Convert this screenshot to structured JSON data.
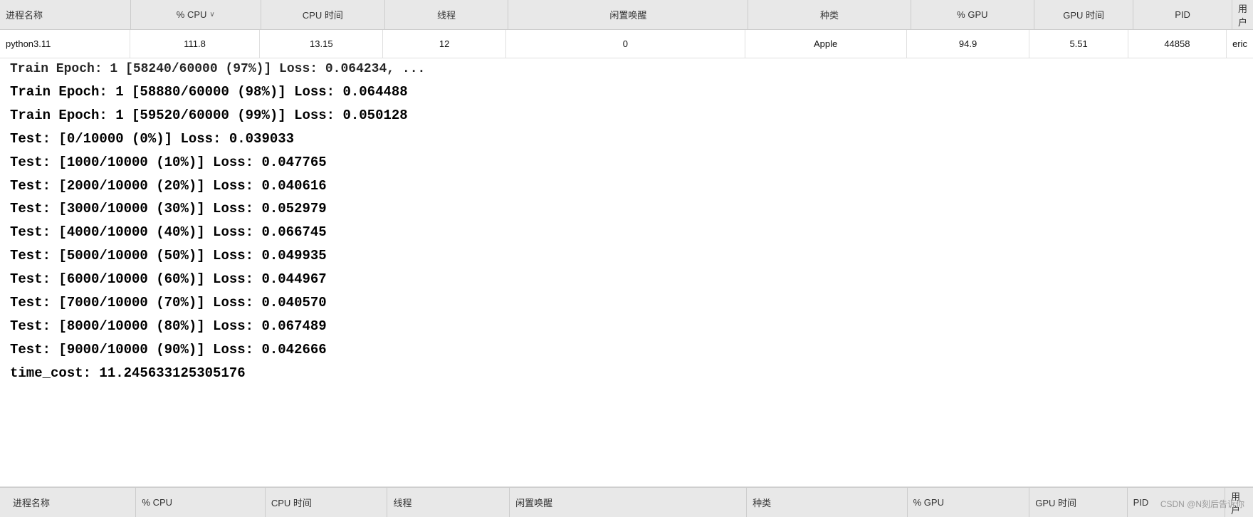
{
  "header": {
    "columns": [
      {
        "id": "process-name",
        "label": "进程名称",
        "sortable": false
      },
      {
        "id": "cpu-pct",
        "label": "% CPU",
        "sortable": true,
        "sort_dir": "desc"
      },
      {
        "id": "cpu-time",
        "label": "CPU 时间",
        "sortable": false
      },
      {
        "id": "threads",
        "label": "线程",
        "sortable": false
      },
      {
        "id": "idle-wake",
        "label": "闲置唤醒",
        "sortable": false
      },
      {
        "id": "kind",
        "label": "种类",
        "sortable": false
      },
      {
        "id": "gpu-pct",
        "label": "% GPU",
        "sortable": false
      },
      {
        "id": "gpu-time",
        "label": "GPU 时间",
        "sortable": false
      },
      {
        "id": "pid",
        "label": "PID",
        "sortable": false
      },
      {
        "id": "user",
        "label": "用户",
        "sortable": false
      }
    ]
  },
  "data_row": {
    "process_name": "python3.11",
    "cpu_pct": "111.8",
    "cpu_time": "13.15",
    "threads": "12",
    "idle_wake": "0",
    "kind": "Apple",
    "gpu_pct": "94.9",
    "gpu_time": "5.51",
    "pid": "44858",
    "user": "eric"
  },
  "terminal": {
    "partial_line": "Train Epoch: 1 [58240/60000 (97%)]    Loss: 0.064234, ...",
    "lines": [
      "Train Epoch: 1 [58880/60000 (98%)]      Loss: 0.064488",
      "Train Epoch: 1 [59520/60000 (99%)]      Loss: 0.050128",
      "Test:  [0/10000 (0%)]     Loss: 0.039033",
      "Test:  [1000/10000 (10%)]      Loss: 0.047765",
      "Test:  [2000/10000 (20%)]      Loss: 0.040616",
      "Test:  [3000/10000 (30%)]      Loss: 0.052979",
      "Test:  [4000/10000 (40%)]      Loss: 0.066745",
      "Test:  [5000/10000 (50%)]      Loss: 0.049935",
      "Test:  [6000/10000 (60%)]      Loss: 0.044967",
      "Test:  [7000/10000 (70%)]      Loss: 0.040570",
      "Test:  [8000/10000 (80%)]      Loss: 0.067489",
      "Test:  [9000/10000 (90%)]      Loss: 0.042666",
      "time_cost: 11.245633125305176"
    ]
  },
  "bottom_bar": {
    "columns": [
      {
        "id": "process-name",
        "label": "进程名称"
      },
      {
        "id": "cpu-pct",
        "label": "% CPU"
      },
      {
        "id": "cpu-time",
        "label": "CPU 时间"
      },
      {
        "id": "threads",
        "label": "线程"
      },
      {
        "id": "idle-wake",
        "label": "闲置唤醒"
      },
      {
        "id": "kind",
        "label": "种类"
      },
      {
        "id": "gpu-pct",
        "label": "% GPU"
      },
      {
        "id": "gpu-time",
        "label": "GPU 时间"
      },
      {
        "id": "pid",
        "label": "PID"
      },
      {
        "id": "user",
        "label": "用户"
      }
    ]
  },
  "watermark": "CSDN @N刻后告诉你"
}
